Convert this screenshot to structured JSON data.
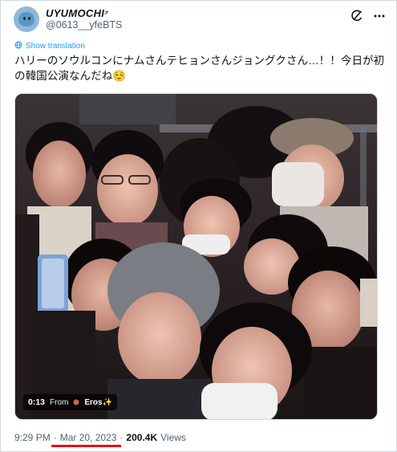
{
  "author": {
    "display_name": "UYUMOCHI⁷",
    "handle": "@0613__yfeBTS"
  },
  "translate_link": "Show translation",
  "tweet_text": "ハリーのソウルコンにナムさんテヒョンさんジョングクさん…！！今日が初の韓国公演なんだね☺️",
  "video": {
    "duration": "0:13",
    "from_label": "From",
    "source_name": "Eros✨"
  },
  "meta": {
    "time": "9:29 PM",
    "separator": "·",
    "date": "Mar 20, 2023",
    "views_count": "200.4K",
    "views_label": "Views"
  },
  "colors": {
    "link_blue": "#1d9bf0",
    "muted": "#536471",
    "highlight_underline": "#e0101a"
  },
  "icons": [
    "grok-icon",
    "more-icon",
    "globe-icon"
  ]
}
